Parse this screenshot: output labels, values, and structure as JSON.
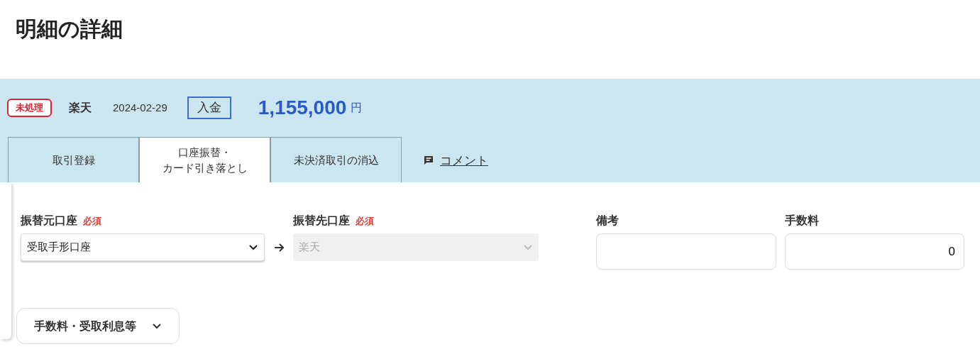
{
  "page_title": "明細の詳細",
  "summary": {
    "status": "未処理",
    "account": "楽天",
    "date": "2024-02-29",
    "type": "入金",
    "amount": "1,155,000",
    "currency": "円"
  },
  "tabs": [
    {
      "label": "取引登録",
      "selected": false
    },
    {
      "lines": [
        "口座振替・",
        "カード引き落とし"
      ],
      "selected": true
    },
    {
      "label": "未決済取引の消込",
      "selected": false
    }
  ],
  "comment_link": "コメント",
  "form": {
    "from": {
      "label": "振替元口座",
      "required": "必須",
      "value": "受取手形口座",
      "disabled": false
    },
    "to": {
      "label": "振替先口座",
      "required": "必須",
      "value": "楽天",
      "disabled": true
    },
    "memo": {
      "label": "備考"
    },
    "fee": {
      "label": "手数料",
      "value": "0"
    }
  },
  "expand_button": {
    "label": "手数料・受取利息等",
    "expanded": false
  }
}
